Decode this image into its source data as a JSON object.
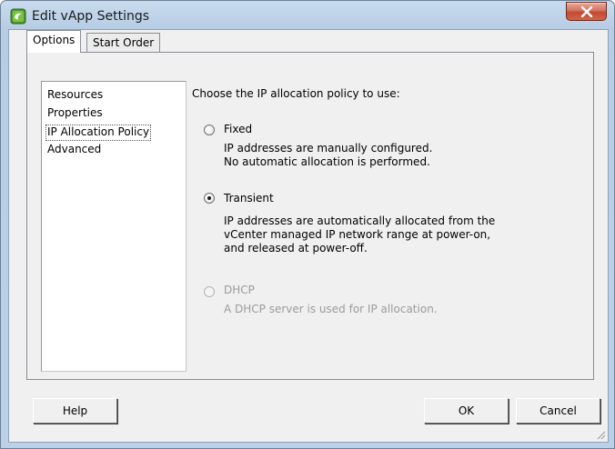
{
  "window": {
    "title": "Edit vApp Settings",
    "app_icon": "vapp-icon",
    "close_icon": "close-icon"
  },
  "tabs": [
    {
      "label": "Options",
      "active": true
    },
    {
      "label": "Start Order",
      "active": false
    }
  ],
  "nav": {
    "items": [
      {
        "label": "Resources"
      },
      {
        "label": "Properties"
      },
      {
        "label": "IP Allocation Policy",
        "selected": true
      },
      {
        "label": "Advanced"
      }
    ]
  },
  "content": {
    "prompt": "Choose the IP allocation policy to use:",
    "options": [
      {
        "label": "Fixed",
        "checked": false,
        "enabled": true,
        "description": [
          "IP addresses are manually configured.",
          "No automatic allocation is performed."
        ]
      },
      {
        "label": "Transient",
        "checked": true,
        "enabled": true,
        "description": [
          "IP addresses are automatically allocated from the",
          "vCenter managed IP network range at power-on,",
          "and released at power-off."
        ]
      },
      {
        "label": "DHCP",
        "checked": false,
        "enabled": false,
        "description": [
          "A DHCP server is used for IP allocation."
        ]
      }
    ]
  },
  "buttons": {
    "help": "Help",
    "ok": "OK",
    "cancel": "Cancel"
  },
  "colors": {
    "title_bar": "#bcd1e7",
    "close_button": "#c2492f",
    "disabled_text": "#9b9b9b"
  }
}
